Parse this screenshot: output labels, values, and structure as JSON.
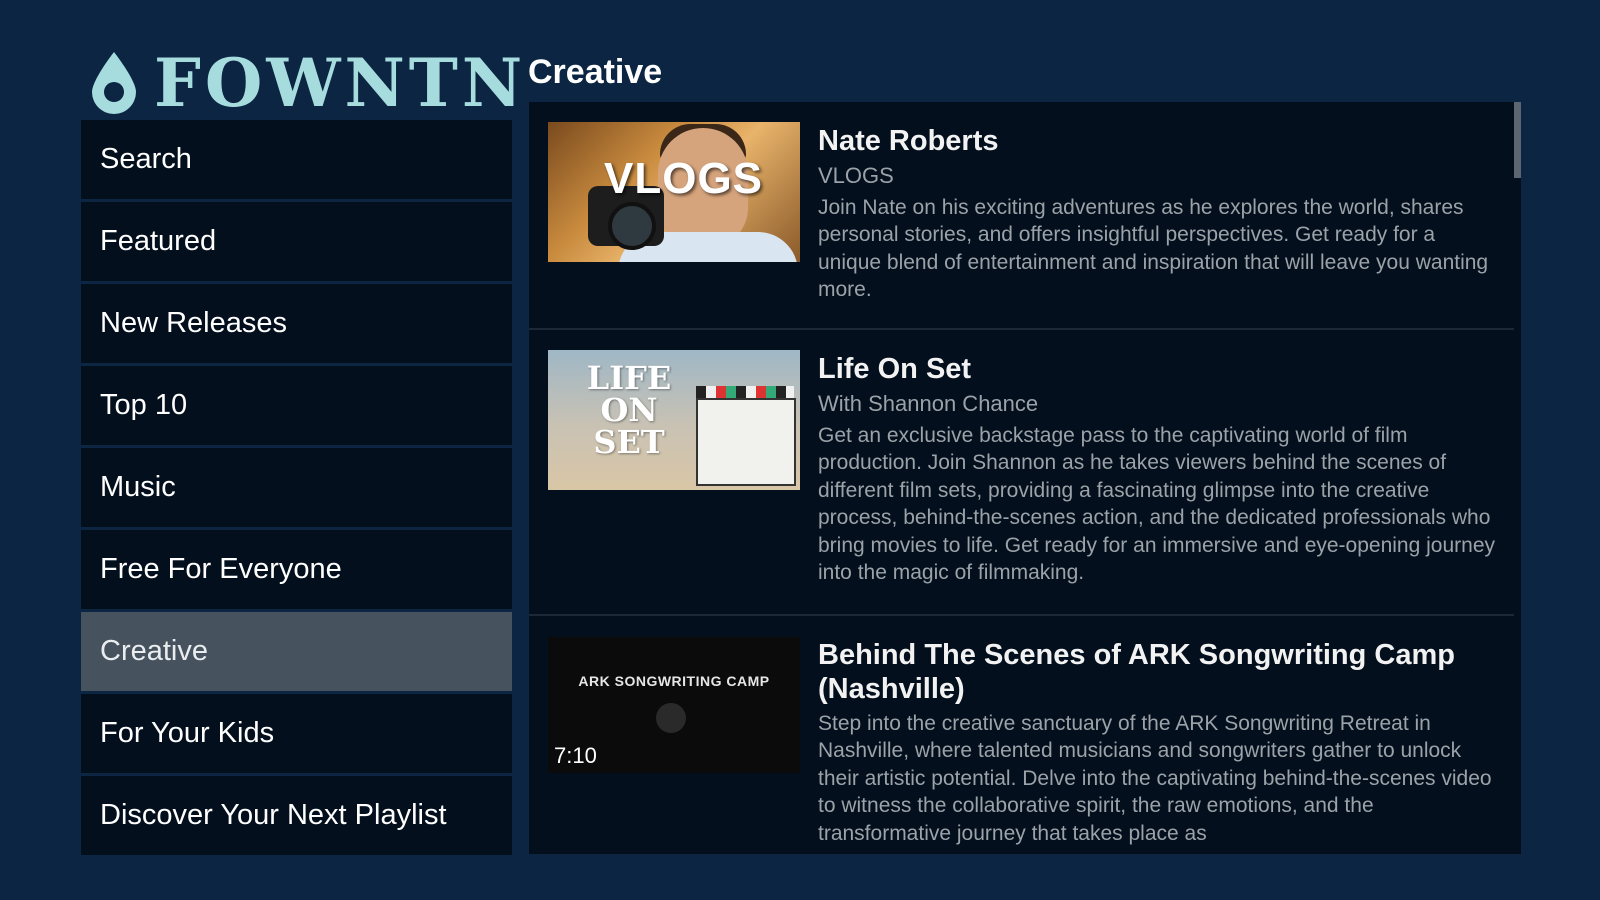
{
  "brand": {
    "logo_text": "FOWNTN",
    "accent": "#a7dcdf"
  },
  "header": {
    "title": "Creative"
  },
  "sidebar": {
    "items": [
      {
        "label": "Search",
        "active": false
      },
      {
        "label": "Featured",
        "active": false
      },
      {
        "label": "New Releases",
        "active": false
      },
      {
        "label": "Top 10",
        "active": false
      },
      {
        "label": "Music",
        "active": false
      },
      {
        "label": "Free For Everyone",
        "active": false
      },
      {
        "label": "Creative",
        "active": true
      },
      {
        "label": "For Your Kids",
        "active": false
      },
      {
        "label": "Discover Your Next Playlist",
        "active": false
      }
    ]
  },
  "list": {
    "items": [
      {
        "title": "Nate Roberts",
        "subtitle": "VLOGS",
        "description": "Join Nate on his exciting adventures as he explores the world, shares personal stories, and offers insightful perspectives. Get ready for a unique blend of entertainment and inspiration that will leave you wanting more.",
        "thumb_text": "VLOGS"
      },
      {
        "title": "Life On Set",
        "subtitle": "With Shannon Chance",
        "description": "Get an exclusive backstage pass to the captivating world of film production. Join Shannon as he takes viewers behind the scenes of different film sets, providing a fascinating glimpse into the creative process, behind-the-scenes action, and the dedicated professionals who bring movies to life. Get ready for an immersive and eye-opening journey into the magic of filmmaking.",
        "thumb_text": "LIFE ON SET"
      },
      {
        "title": "Behind The Scenes of ARK Songwriting Camp (Nashville)",
        "subtitle": "",
        "description": "Step into the creative sanctuary of the ARK Songwriting Retreat in Nashville, where talented musicians and songwriters gather to unlock their artistic potential. Delve into the captivating behind-the-scenes video to witness the collaborative spirit, the raw emotions, and the transformative journey that takes place as",
        "thumb_text": "ARK SONGWRITING CAMP",
        "duration": "7:10"
      }
    ]
  }
}
